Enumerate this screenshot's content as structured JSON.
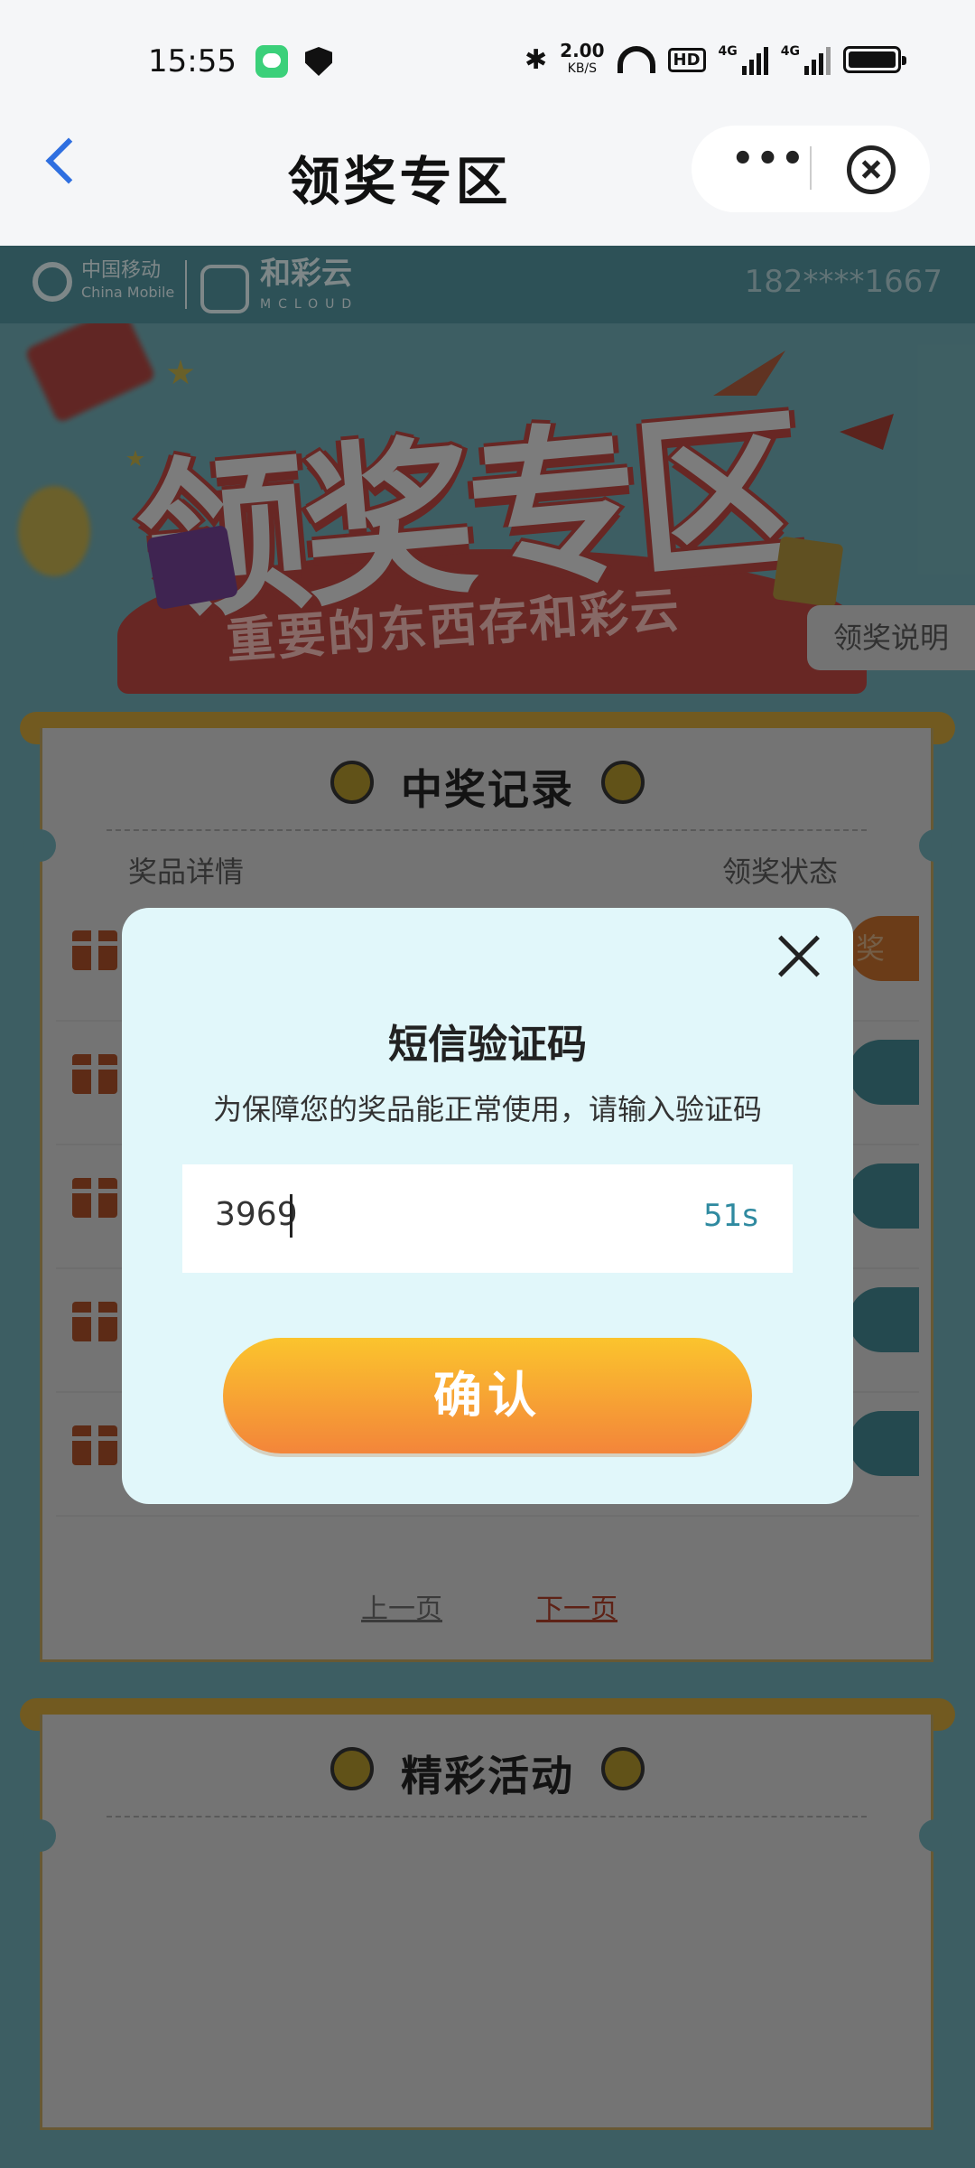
{
  "status_bar": {
    "time": "15:55",
    "net_speed_value": "2.00",
    "net_speed_unit": "KB/S",
    "hd_label": "HD",
    "signal_label_1": "4G",
    "signal_label_2": "4G"
  },
  "nav": {
    "title": "领奖专区",
    "more_label": "•••"
  },
  "brand": {
    "china_mobile_cn": "中国移动",
    "china_mobile_en": "China Mobile",
    "mcloud_cn": "和彩云",
    "mcloud_en": "MCLOUD",
    "phone_masked": "182****1667"
  },
  "hero": {
    "title": "领奖专区",
    "slogan": "重要的东西存和彩云",
    "rules_button": "领奖说明"
  },
  "records": {
    "title": "中奖记录",
    "col_prize": "奖品详情",
    "col_status": "领奖状态",
    "first_status_fragment": "奖",
    "prev_page": "上一页",
    "next_page": "下一页"
  },
  "activities": {
    "title": "精彩活动"
  },
  "modal": {
    "title": "短信验证码",
    "subtitle": "为保障您的奖品能正常使用，请输入验证码",
    "code_value": "3969",
    "countdown": "51s",
    "confirm_label": "确认"
  },
  "colors": {
    "accent_blue": "#2f6fe0",
    "modal_bg": "#e1f7fa",
    "confirm_gradient_top": "#fbc42d",
    "confirm_gradient_bottom": "#f3853a",
    "timer_teal": "#2f8aa0"
  }
}
